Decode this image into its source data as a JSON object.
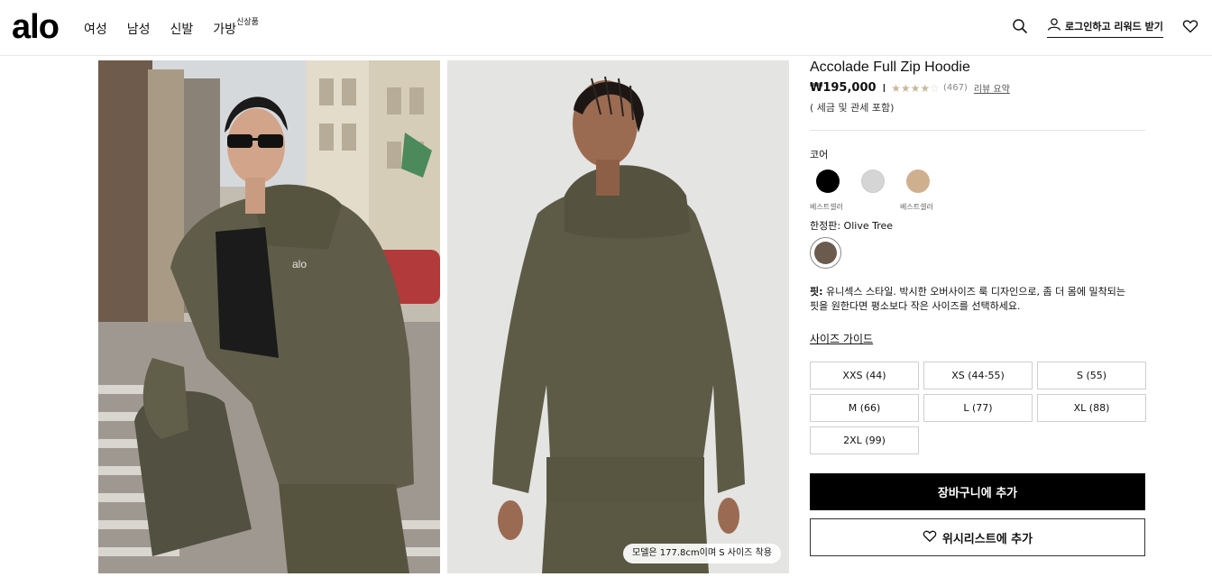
{
  "header": {
    "logo": "alo",
    "nav": [
      {
        "label": "여성"
      },
      {
        "label": "남성"
      },
      {
        "label": "신발"
      },
      {
        "label": "가방",
        "sup": "신상품"
      }
    ],
    "login_label": "로그인하고 리워드 받기",
    "icons": {
      "search": "search-icon",
      "user": "user-icon",
      "wishlist": "heart-icon"
    }
  },
  "gallery": {
    "images": [
      {
        "alt": "lifestyle-photo-model-street"
      },
      {
        "alt": "studio-photo-model-back"
      }
    ],
    "model_badge": "모델은 177.8cm이며 S 사이즈 착용"
  },
  "product": {
    "title": "Accolade Full Zip Hoodie",
    "price": "₩195,000",
    "price_separator": "I",
    "rating": 4,
    "rating_max": 5,
    "review_count": "(467)",
    "review_summary": "리뷰 요약",
    "tax_note": "( 세금 및 관세 포함)",
    "core_label": "코어",
    "core_swatches": [
      {
        "color": "#000000",
        "tag": "베스트셀러"
      },
      {
        "color": "#d5d5d5",
        "tag": ""
      },
      {
        "color": "#cfb08e",
        "tag": "베스트셀러"
      }
    ],
    "limited_label": "한정판: Olive Tree",
    "limited_swatch_color": "#6b5a4e",
    "fit_label": "핏:",
    "fit_text": " 유니섹스 스타일. 박시한 오버사이즈 룩 디자인으로, 좀 더 몸에 밀착되는 핏을 원한다면 평소보다 작은 사이즈를 선택하세요.",
    "size_guide": "사이즈 가이드",
    "sizes": [
      "XXS (44)",
      "XS (44-55)",
      "S (55)",
      "M (66)",
      "L (77)",
      "XL (88)",
      "2XL (99)"
    ],
    "add_to_cart": "장바구니에 추가",
    "add_to_wishlist": "위시리스트에 추가"
  }
}
